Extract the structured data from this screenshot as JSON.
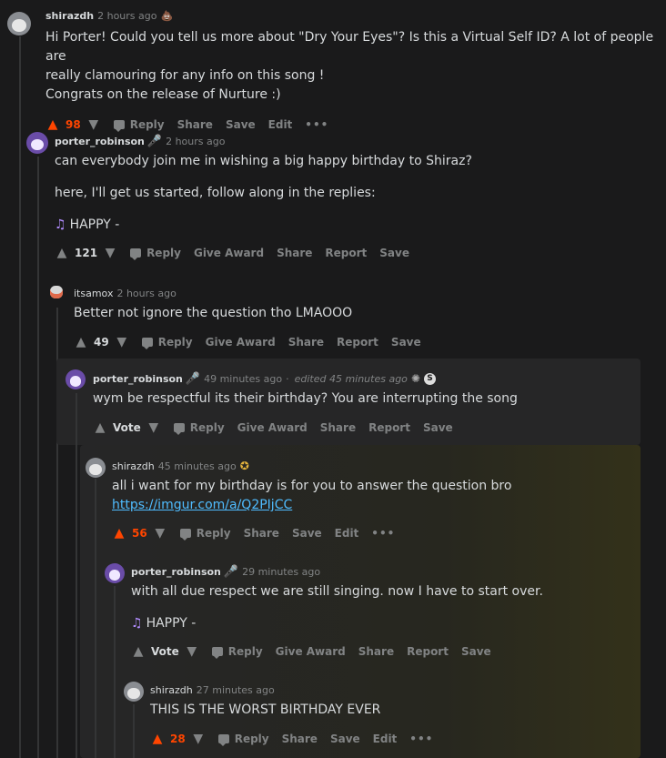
{
  "comments": [
    {
      "username": "shirazdh",
      "time": "2 hours ago",
      "lines": [
        "Hi Porter! Could you tell us more about \"Dry Your Eyes\"? Is this a Virtual Self ID? A lot of people are",
        "really clamouring for any info on this song !",
        "Congrats on the release of Nurture :)"
      ],
      "score": "98",
      "actions": [
        "Reply",
        "Share",
        "Save",
        "Edit"
      ]
    },
    {
      "username": "porter_robinson",
      "time": "2 hours ago",
      "line1": "can everybody join me in wishing a big happy birthday to Shiraz?",
      "line2": "here, I'll get us started, follow along in the replies:",
      "song": "HAPPY -",
      "score": "121",
      "actions": [
        "Reply",
        "Give Award",
        "Share",
        "Report",
        "Save"
      ]
    },
    {
      "username": "itsamox",
      "time": "2 hours ago",
      "line1": "Better not ignore the question tho LMAOOO",
      "score": "49",
      "actions": [
        "Reply",
        "Give Award",
        "Share",
        "Report",
        "Save"
      ]
    },
    {
      "username": "porter_robinson",
      "time": "49 minutes ago",
      "edited": "edited 45 minutes ago",
      "line1": "wym be respectful its their birthday? You are interrupting the song",
      "score": "Vote",
      "actions": [
        "Reply",
        "Give Award",
        "Share",
        "Report",
        "Save"
      ]
    },
    {
      "username": "shirazdh",
      "time": "45 minutes ago",
      "line1": "all i want for my birthday is for you to answer the question bro",
      "link": "https://imgur.com/a/Q2PIjCC",
      "score": "56",
      "actions": [
        "Reply",
        "Share",
        "Save",
        "Edit"
      ]
    },
    {
      "username": "porter_robinson",
      "time": "29 minutes ago",
      "line1": "with all due respect we are still singing. now I have to start over.",
      "song": "HAPPY -",
      "score": "Vote",
      "actions": [
        "Reply",
        "Give Award",
        "Share",
        "Report",
        "Save"
      ]
    },
    {
      "username": "shirazdh",
      "time": "27 minutes ago",
      "line1": "THIS IS THE WORST BIRTHDAY EVER",
      "score": "28",
      "actions": [
        "Reply",
        "Share",
        "Save",
        "Edit"
      ]
    }
  ],
  "icons": {
    "upvote": "▲",
    "downvote": "▼",
    "mic": "microphone-icon",
    "note": "♫",
    "more": "•••",
    "badge_poop": "💩",
    "badge_gold": "award-icon"
  },
  "colors": {
    "background": "#1a1a1b",
    "text": "#d7dadc",
    "muted": "#818384",
    "upvoted": "#ff4500",
    "link": "#4fbcff"
  }
}
